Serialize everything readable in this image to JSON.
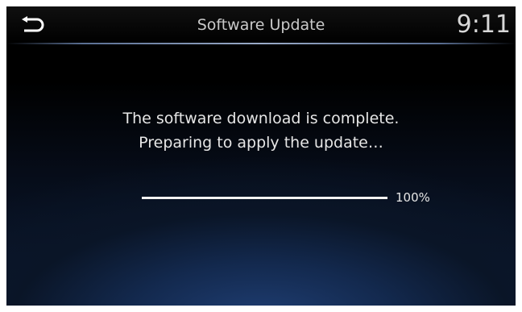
{
  "header": {
    "title": "Software Update",
    "clock": "9:11",
    "back_icon": "back-arrow-icon"
  },
  "message": {
    "line1": "The software download is complete.",
    "line2": "Preparing to apply the update…"
  },
  "progress": {
    "percent": 100,
    "label": "100%"
  },
  "colors": {
    "header_bg": "#000000",
    "accent_blue": "#1f3e73",
    "text": "#e6e6e6",
    "progress_fill": "#f2f2f2"
  }
}
